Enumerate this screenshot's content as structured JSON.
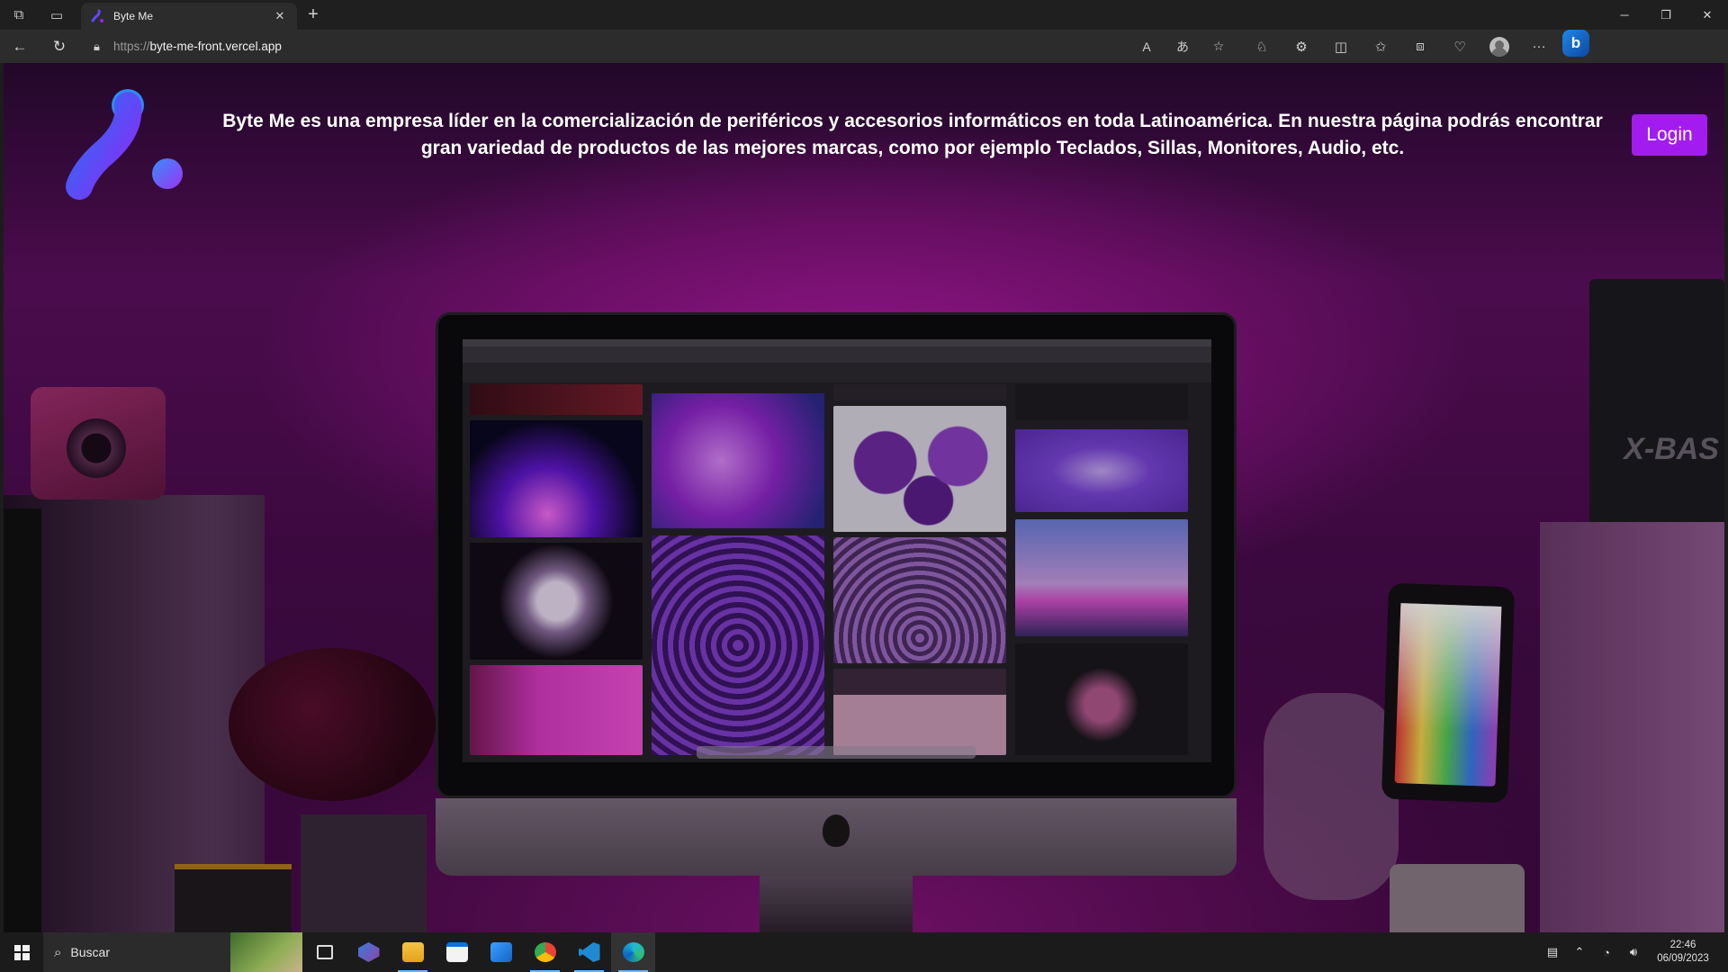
{
  "browser": {
    "tab_title": "Byte Me",
    "new_tab_icon": "plus-icon",
    "url_protocol": "https://",
    "url_host": "byte-me-front.vercel.app"
  },
  "site": {
    "tagline": "Byte Me es una empresa líder en la comercialización de periféricos y accesorios informáticos en toda Latinoamérica. En nuestra página podrás encontrar gran variedad de productos de las mejores marcas, como por ejemplo Teclados, Sillas, Monitores, Audio, etc.",
    "login_label": "Login",
    "accent_color": "#a21cf0",
    "logo_gradient": [
      "#2b6cf6",
      "#8b2cf5"
    ]
  },
  "background": {
    "speaker_brand": "X-BAS"
  },
  "taskbar": {
    "search_placeholder": "Buscar",
    "time": "22:46",
    "date": "06/09/2023"
  }
}
